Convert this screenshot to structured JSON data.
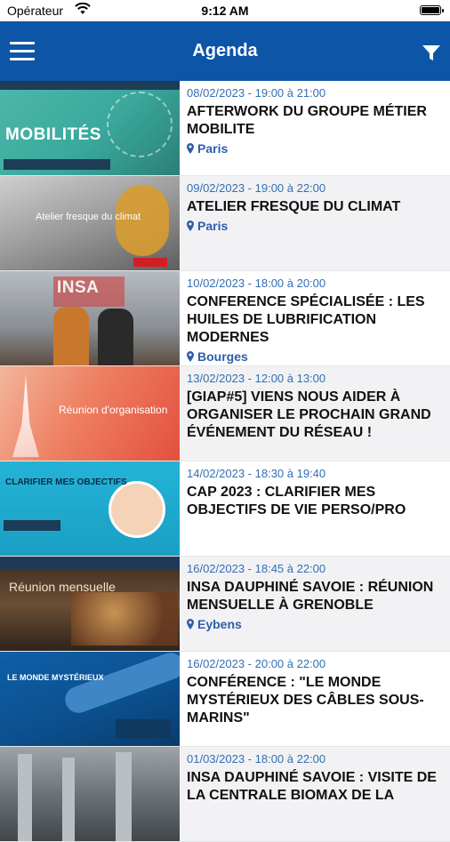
{
  "status_bar": {
    "carrier": "Opérateur",
    "time": "9:12 AM"
  },
  "header": {
    "title": "Agenda"
  },
  "colors": {
    "header": "#0d55a6",
    "date": "#336fb3",
    "location": "#2f5ea8"
  },
  "events": [
    {
      "date": "08/02/2023 - 19:00 à 21:00",
      "title": "AFTERWORK DU GROUPE MÉTIER MOBILITE",
      "location": "Paris",
      "thumb_text": "MOBILITÉS"
    },
    {
      "date": "09/02/2023 - 19:00 à 22:00",
      "title": "ATELIER FRESQUE DU CLIMAT",
      "location": "Paris",
      "thumb_text": "Atelier fresque du climat"
    },
    {
      "date": "10/02/2023 - 18:00 à 20:00",
      "title": "CONFERENCE SPÉCIALISÉE : LES HUILES DE LUBRIFICATION MODERNES",
      "location": "Bourges",
      "thumb_text": "INSA"
    },
    {
      "date": "13/02/2023 - 12:00 à 13:00",
      "title": "[GIAP#5] VIENS NOUS AIDER À ORGANISER LE PROCHAIN GRAND ÉVÉNEMENT DU RÉSEAU !",
      "location": "",
      "thumb_text": "Réunion d'organisation"
    },
    {
      "date": "14/02/2023 - 18:30 à 19:40",
      "title": "CAP 2023 : CLARIFIER MES OBJECTIFS DE VIE PERSO/PRO",
      "location": "",
      "thumb_text": "CLARIFIER MES OBJECTIFS"
    },
    {
      "date": "16/02/2023 - 18:45 à 22:00",
      "title": "INSA DAUPHINÉ SAVOIE : RÉUNION MENSUELLE À GRENOBLE",
      "location": "Eybens",
      "thumb_text": "Réunion mensuelle"
    },
    {
      "date": "16/02/2023 - 20:00 à 22:00",
      "title": "CONFÉRENCE : \"LE MONDE MYSTÉRIEUX DES CÂBLES SOUS-MARINS\"",
      "location": "",
      "thumb_text": "LE MONDE MYSTÉRIEUX"
    },
    {
      "date": "01/03/2023 - 18:00 à 22:00",
      "title": "INSA DAUPHINÉ SAVOIE : VISITE DE LA CENTRALE BIOMAX DE LA",
      "location": "",
      "thumb_text": ""
    }
  ]
}
